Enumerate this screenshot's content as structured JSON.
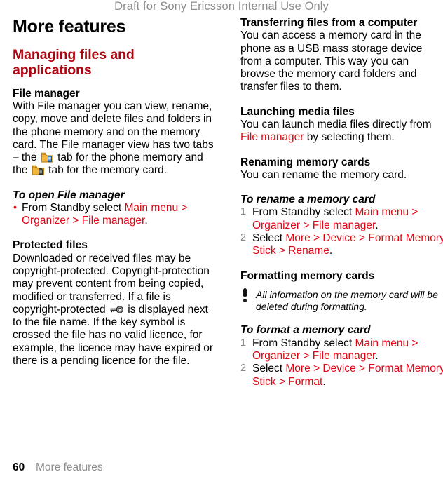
{
  "draft_notice": "Draft for Sony Ericsson Internal Use Only",
  "chapter_title": "More features",
  "left_column": {
    "section_title": "Managing files and applications",
    "file_manager": {
      "heading": "File manager",
      "text_1": "With File manager you can view, rename, copy, move and delete files and folders in the phone memory and on the memory card. The File manager view has two tabs – the ",
      "text_2": " tab for the phone memory and the ",
      "text_3": " tab for the memory card.",
      "icon_phone_tab": "folder-phone-icon",
      "icon_card_tab": "folder-memory-card-icon"
    },
    "task_open": {
      "heading": "To open File manager",
      "bullet_1_plain": "From Standby select ",
      "bullet_1_path": "Main menu > Organizer > File manager",
      "bullet_1_end": "."
    },
    "protected_files": {
      "heading": "Protected files",
      "text_1": "Downloaded or received files may be copyright-protected. Copyright-protection may prevent content from being copied, modified or transferred. If a file is copyright-protected ",
      "text_2": " is displayed next to the file name. If the key symbol is crossed the file has no valid licence, for example, the licence may have expired or there is a pending licence for the file.",
      "icon_key": "key-icon"
    }
  },
  "right_column": {
    "transferring": {
      "heading": "Transferring files from a computer",
      "text": "You can access a memory card in the phone as a USB mass storage device from a computer. This way you can browse the memory card folders and transfer files to them."
    },
    "launching": {
      "heading": "Launching media files",
      "text_1": "You can launch media files directly from ",
      "link": "File manager",
      "text_2": " by selecting them."
    },
    "renaming": {
      "heading": "Renaming memory cards",
      "text": "You can rename the memory card.",
      "task_heading": "To rename a memory card",
      "steps": [
        {
          "plain_1": "From Standby select ",
          "path": "Main menu > Organizer > File manager",
          "plain_2": "."
        },
        {
          "plain_1": "Select ",
          "path": "More > Device > Format Memory Stick > Rename",
          "plain_2": "."
        }
      ]
    },
    "formatting": {
      "heading": "Formatting memory cards",
      "note_icon": "exclamation-icon",
      "note": "All information on the memory card will be deleted during formatting.",
      "task_heading": "To format a memory card",
      "steps": [
        {
          "plain_1": "From Standby select ",
          "path": "Main menu > Organizer > File manager",
          "plain_2": "."
        },
        {
          "plain_1": "Select ",
          "path": "More > Device > Format Memory Stick > Format",
          "plain_2": "."
        }
      ]
    }
  },
  "footer": {
    "page_number": "60",
    "title": "More features"
  },
  "colors": {
    "section_red": "#AE0512",
    "link_red": "#E00613",
    "draft_gray": "#8C8C8C",
    "step_number_gray": "#8A8A8A",
    "folder_yellow": "#F5B642",
    "phone_blue": "#2E7FC4"
  }
}
